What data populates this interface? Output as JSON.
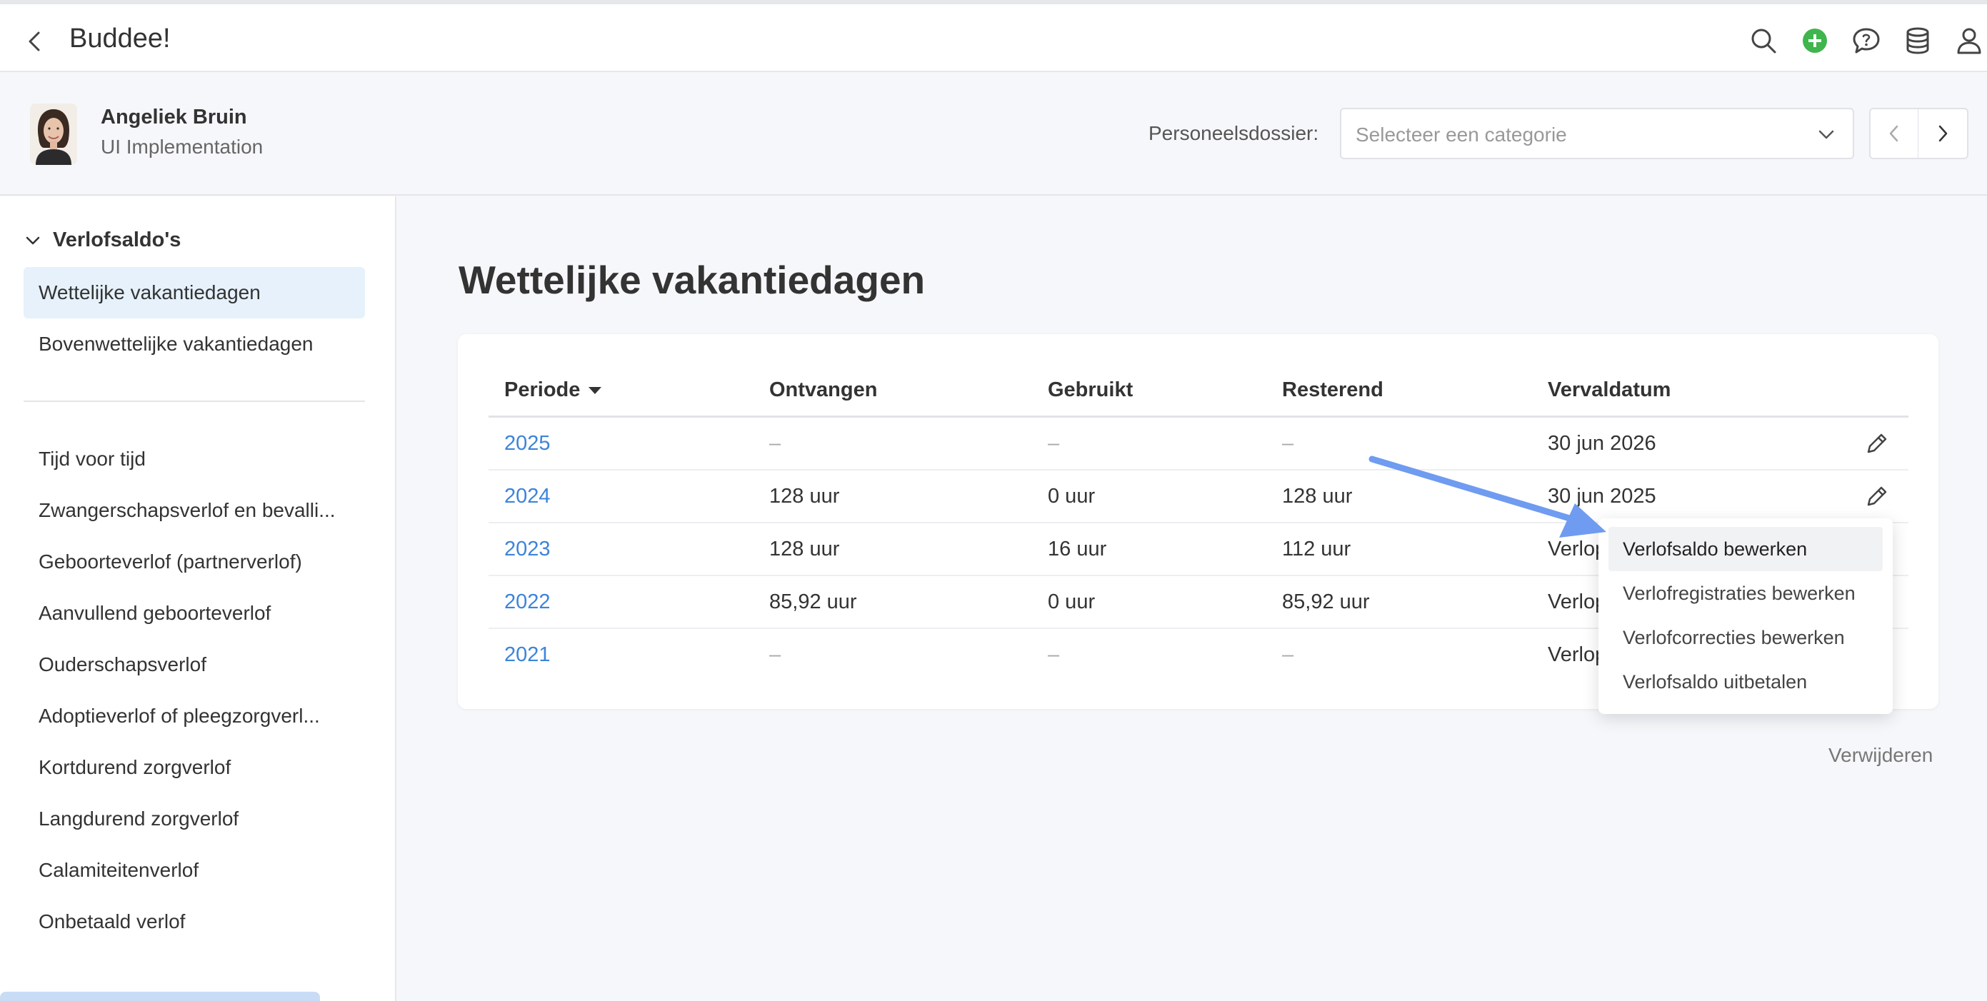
{
  "topbar": {
    "title": "Buddee!",
    "icons": [
      "search-icon",
      "add-icon",
      "help-chat-icon",
      "database-icon",
      "user-icon"
    ],
    "add_color": "#3fb54d"
  },
  "employee": {
    "name": "Angeliek Bruin",
    "role": "UI Implementation",
    "dossier_label": "Personeelsdossier:",
    "dossier_placeholder": "Selecteer een categorie"
  },
  "sidebar": {
    "section_title": "Verlofsaldo's",
    "section_items": [
      {
        "label": "Wettelijke vakantiedagen",
        "active": true
      },
      {
        "label": "Bovenwettelijke vakantiedagen",
        "active": false
      }
    ],
    "items": [
      {
        "label": "Tijd voor tijd"
      },
      {
        "label": "Zwangerschapsverlof en bevalli..."
      },
      {
        "label": "Geboorteverlof (partnerverlof)"
      },
      {
        "label": "Aanvullend geboorteverlof"
      },
      {
        "label": "Ouderschapsverlof"
      },
      {
        "label": "Adoptieverlof of pleegzorgverl..."
      },
      {
        "label": "Kortdurend zorgverlof"
      },
      {
        "label": "Langdurend zorgverlof"
      },
      {
        "label": "Calamiteitenverlof"
      },
      {
        "label": "Onbetaald verlof"
      }
    ]
  },
  "main": {
    "title": "Wettelijke vakantiedagen",
    "table": {
      "headers": [
        "Periode",
        "Ontvangen",
        "Gebruikt",
        "Resterend",
        "Vervaldatum"
      ],
      "rows": [
        {
          "periode": "2025",
          "ontvangen": "–",
          "gebruikt": "–",
          "resterend": "–",
          "vervaldatum": "30 jun 2026"
        },
        {
          "periode": "2024",
          "ontvangen": "128 uur",
          "gebruikt": "0 uur",
          "resterend": "128 uur",
          "vervaldatum": "30 jun 2025"
        },
        {
          "periode": "2023",
          "ontvangen": "128 uur",
          "gebruikt": "16 uur",
          "resterend": "112 uur",
          "vervaldatum": "Verlop"
        },
        {
          "periode": "2022",
          "ontvangen": "85,92 uur",
          "gebruikt": "0 uur",
          "resterend": "85,92 uur",
          "vervaldatum": "Verlop"
        },
        {
          "periode": "2021",
          "ontvangen": "–",
          "gebruikt": "–",
          "resterend": "–",
          "vervaldatum": "Verlop"
        }
      ]
    },
    "delete_label": "Verwijderen",
    "link_color": "#3d84d9"
  },
  "menu": {
    "items": [
      {
        "label": "Verlofsaldo bewerken",
        "hover": true
      },
      {
        "label": "Verlofregistraties bewerken",
        "hover": false
      },
      {
        "label": "Verlofcorrecties bewerken",
        "hover": false
      },
      {
        "label": "Verlofsaldo uitbetalen",
        "hover": false
      }
    ]
  },
  "annotation_color": "#6f9bf0"
}
